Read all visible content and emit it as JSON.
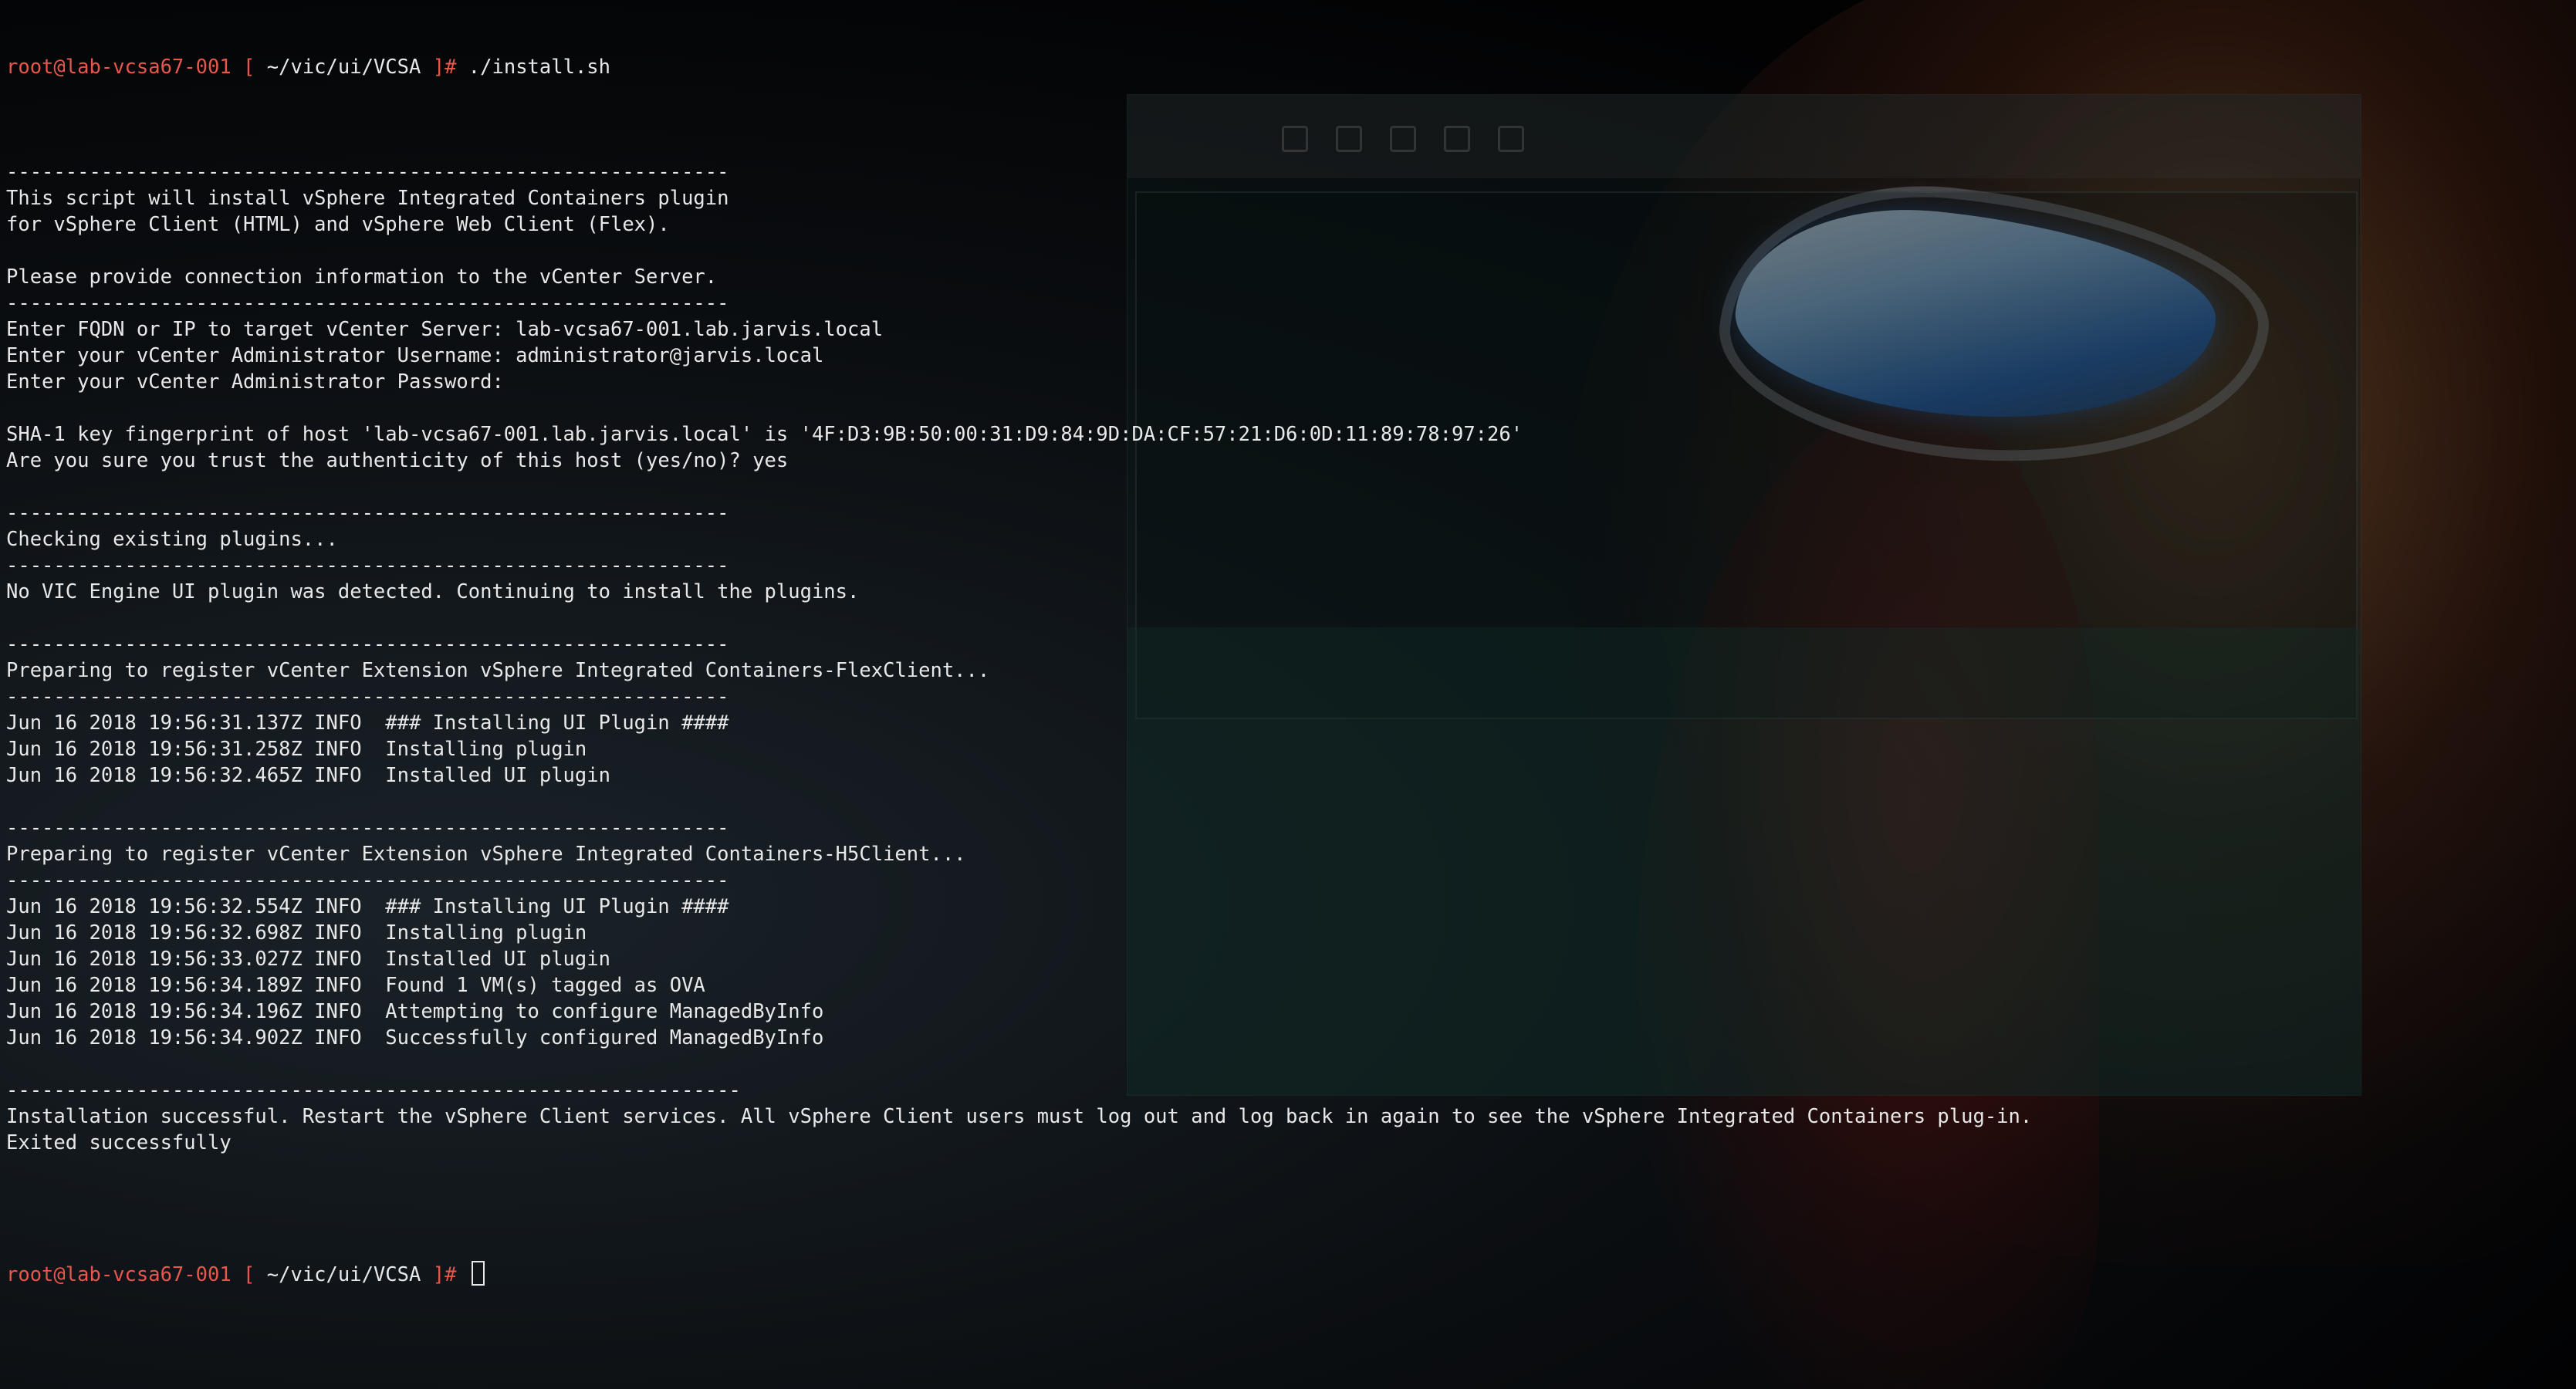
{
  "colors": {
    "prompt": "#e8574b",
    "text": "#e8e8e8",
    "background": "#06080a",
    "eye_glow": "#4a8fe0"
  },
  "prompt": {
    "user_host": "root@lab-vcsa67-001",
    "open_bracket": " [ ",
    "path": "~/vic/ui/VCSA",
    "close_bracket": " ]# "
  },
  "first_command": "./install.sh",
  "output_lines": [
    "-------------------------------------------------------------",
    "This script will install vSphere Integrated Containers plugin",
    "for vSphere Client (HTML) and vSphere Web Client (Flex).",
    "",
    "Please provide connection information to the vCenter Server.",
    "-------------------------------------------------------------",
    "Enter FQDN or IP to target vCenter Server: lab-vcsa67-001.lab.jarvis.local",
    "Enter your vCenter Administrator Username: administrator@jarvis.local",
    "Enter your vCenter Administrator Password:",
    "",
    "SHA-1 key fingerprint of host 'lab-vcsa67-001.lab.jarvis.local' is '4F:D3:9B:50:00:31:D9:84:9D:DA:CF:57:21:D6:0D:11:89:78:97:26'",
    "Are you sure you trust the authenticity of this host (yes/no)? yes",
    "",
    "-------------------------------------------------------------",
    "Checking existing plugins...",
    "-------------------------------------------------------------",
    "No VIC Engine UI plugin was detected. Continuing to install the plugins.",
    "",
    "-------------------------------------------------------------",
    "Preparing to register vCenter Extension vSphere Integrated Containers-FlexClient...",
    "-------------------------------------------------------------",
    "Jun 16 2018 19:56:31.137Z INFO  ### Installing UI Plugin ####",
    "Jun 16 2018 19:56:31.258Z INFO  Installing plugin",
    "Jun 16 2018 19:56:32.465Z INFO  Installed UI plugin",
    "",
    "-------------------------------------------------------------",
    "Preparing to register vCenter Extension vSphere Integrated Containers-H5Client...",
    "-------------------------------------------------------------",
    "Jun 16 2018 19:56:32.554Z INFO  ### Installing UI Plugin ####",
    "Jun 16 2018 19:56:32.698Z INFO  Installing plugin",
    "Jun 16 2018 19:56:33.027Z INFO  Installed UI plugin",
    "Jun 16 2018 19:56:34.189Z INFO  Found 1 VM(s) tagged as OVA",
    "Jun 16 2018 19:56:34.196Z INFO  Attempting to configure ManagedByInfo",
    "Jun 16 2018 19:56:34.902Z INFO  Successfully configured ManagedByInfo",
    "",
    "--------------------------------------------------------------",
    "Installation successful. Restart the vSphere Client services. All vSphere Client users must log out and log back in again to see the vSphere Integrated Containers plug-in.",
    "Exited successfully",
    ""
  ]
}
